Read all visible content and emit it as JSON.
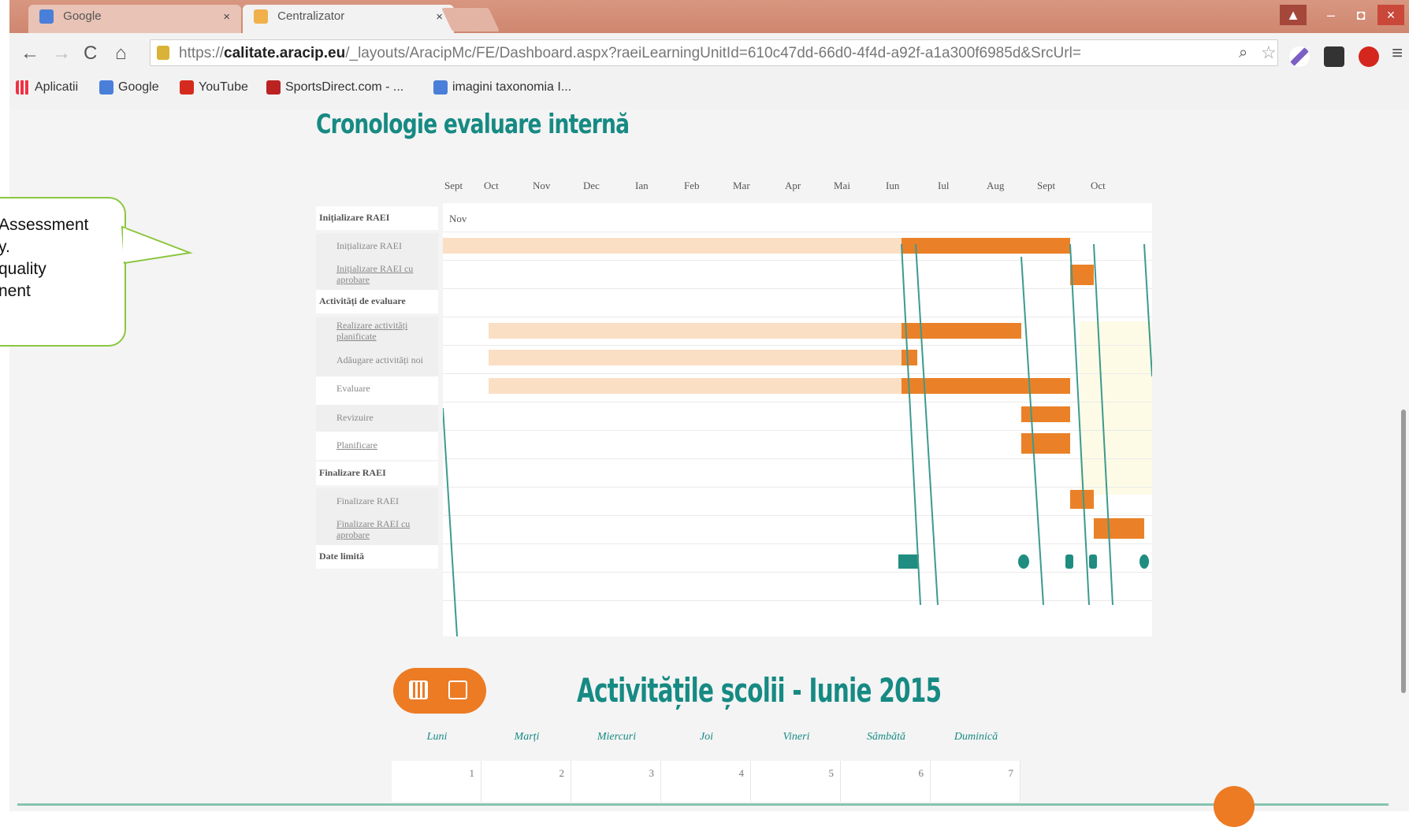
{
  "browser": {
    "tabs": [
      {
        "label": "Google",
        "active": false
      },
      {
        "label": "Centralizator",
        "active": true
      }
    ],
    "url_prefix": "https://",
    "url_host": "calitate.aracip.eu",
    "url_path": "/_layouts/AracipMc/FE/Dashboard.aspx?raeiLearningUnitId=610c47dd-66d0-4f4d-a92f-a1a300f6985d&SrcUrl=",
    "bookmarks": [
      "Aplicatii",
      "Google",
      "YouTube",
      "SportsDirect.com - ...",
      "imagini taxonomia I..."
    ],
    "icons": {
      "back": "back-arrow-icon",
      "forward": "forward-arrow-icon",
      "reload": "reload-icon",
      "home": "home-icon",
      "search": "search-icon",
      "star": "star-icon"
    }
  },
  "callout": {
    "lines": [
      "Assessment",
      "y.",
      "quality",
      "nent"
    ]
  },
  "timeline": {
    "title": "Cronologie evaluare internă",
    "months": [
      "Sept",
      "Oct",
      "Nov",
      "Dec",
      "Ian",
      "Feb",
      "Mar",
      "Apr",
      "Mai",
      "Iun",
      "Iul",
      "Aug",
      "Sept",
      "Oct"
    ],
    "sub_month": "Nov",
    "rows": [
      {
        "label": "Inițializare RAEI",
        "group": true
      },
      {
        "label": "Inițializare RAEI",
        "group": false
      },
      {
        "label": "Inițializare RAEI cu aprobare",
        "group": false
      },
      {
        "label": "Activități de evaluare",
        "group": true
      },
      {
        "label": "Realizare activități planificate",
        "group": false
      },
      {
        "label": "Adăugare activități noi",
        "group": false
      },
      {
        "label": "Evaluare",
        "group": false
      },
      {
        "label": "Revizuire",
        "group": false
      },
      {
        "label": "Planificare",
        "group": false
      },
      {
        "label": "Finalizare RAEI",
        "group": true
      },
      {
        "label": "Finalizare RAEI",
        "group": false
      },
      {
        "label": "Finalizare RAEI cu aprobare",
        "group": false
      },
      {
        "label": "Date limită",
        "group": true
      }
    ]
  },
  "calendar": {
    "title": "Activitățile școlii - Iunie 2015",
    "days": [
      "Luni",
      "Marți",
      "Miercuri",
      "Joi",
      "Vineri",
      "Sâmbătă",
      "Duminică"
    ],
    "first_week": [
      "1",
      "2",
      "3",
      "4",
      "5",
      "6",
      "7"
    ],
    "toggle_icons": [
      "calendar-month-icon",
      "calendar-day-icon"
    ]
  },
  "colors": {
    "accent": "#168a83",
    "orange": "#ea8128",
    "faded": "#fbdfc5",
    "callout_border": "#8cc63f"
  }
}
